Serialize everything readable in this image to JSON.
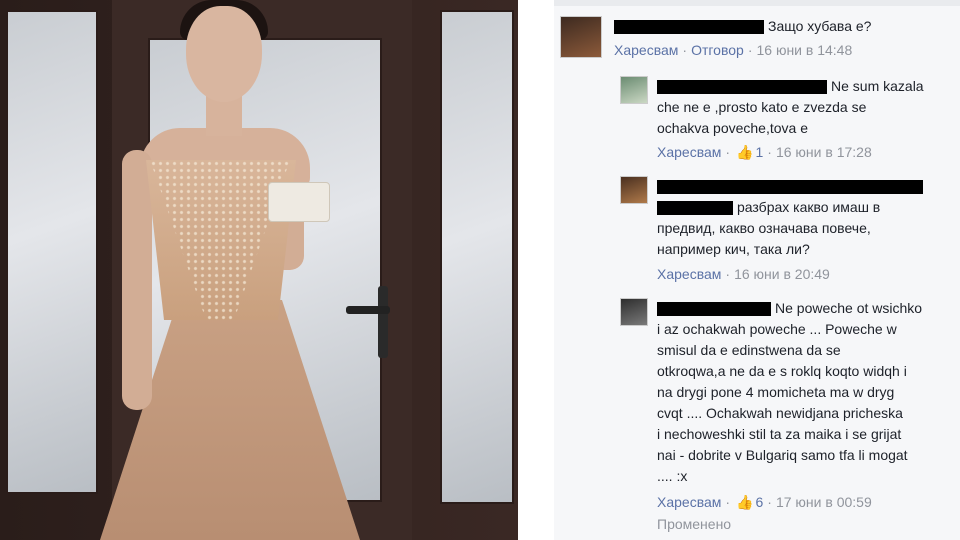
{
  "comments": [
    {
      "text": "Защо хубава е?",
      "like_label": "Харесвам",
      "reply_label": "Отговор",
      "date": "16 юни в 14:48",
      "avatar_icon": "profile-photo"
    },
    {
      "lines": [
        "Ne sum kazala",
        "che ne e ,prosto kato e zvezda se",
        "ochakva poveche,tova e"
      ],
      "like_label": "Харесвам",
      "likes": "1",
      "date": "16 юни в 17:28",
      "avatar_icon": "profile-photo"
    },
    {
      "lines": [
        "разбрах какво имаш в",
        "предвид, какво означава повече,",
        "например кич, така ли?"
      ],
      "like_label": "Харесвам",
      "date": "16 юни в 20:49",
      "avatar_icon": "profile-photo"
    },
    {
      "lines": [
        "Ne poweche ot wsichko",
        "i az ochakwah poweche ... Poweche w",
        "smisul da e edinstwena da se",
        "otkroqwa,a ne da e s roklq koqto widqh i",
        "na drygi pone 4 momicheta ma w dryg",
        "cvqt .... Ochakwah newidjana pricheska",
        "i nechoweshki stil ta za maika i se grijat",
        "nai - dobrite v Bulgariq samo tfa li mogat",
        ".... :x"
      ],
      "like_label": "Харесвам",
      "likes": "6",
      "date": "17 юни в 00:59",
      "edited_label": "Променено",
      "avatar_icon": "profile-photo"
    }
  ],
  "icons": {
    "like": "thumbs-up-icon"
  },
  "colors": {
    "link": "#6d84b4",
    "meta": "#90949c",
    "text": "#1d2129",
    "panel": "#f6f7f9"
  }
}
